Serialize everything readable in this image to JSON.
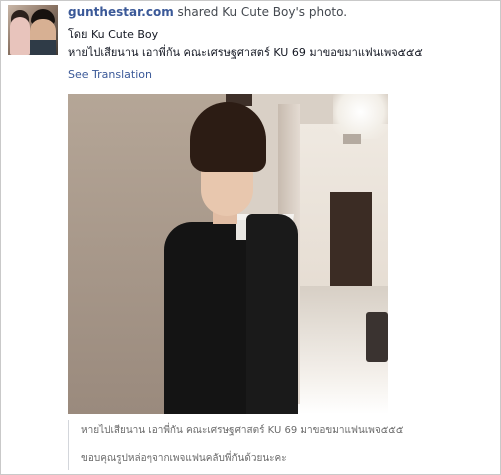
{
  "story": {
    "actor_name": "gunthestar.com",
    "action_text": "shared Ku Cute Boy's photo."
  },
  "post": {
    "by_line": "โดย Ku Cute Boy",
    "caption": "หายไปเสียนาน เอาพี่กัน คณะเศรษฐศาสตร์ KU 69 มาขอขมาแฟนเพจ๕๕๕",
    "see_translation": "See Translation"
  },
  "photo": {
    "description_line1": "หายไปเสียนาน เอาพี่กัน คณะเศรษฐศาสตร์ KU 69 มาขอขมาแฟนเพจ๕๕๕",
    "description_line2": "ขอบคุณรูปหล่อๆจากเพจแฟนคลับพี่กันด้วยนะคะ"
  },
  "colors": {
    "link_blue": "#3b5998",
    "text": "#141823",
    "muted": "#6a6a6a"
  }
}
